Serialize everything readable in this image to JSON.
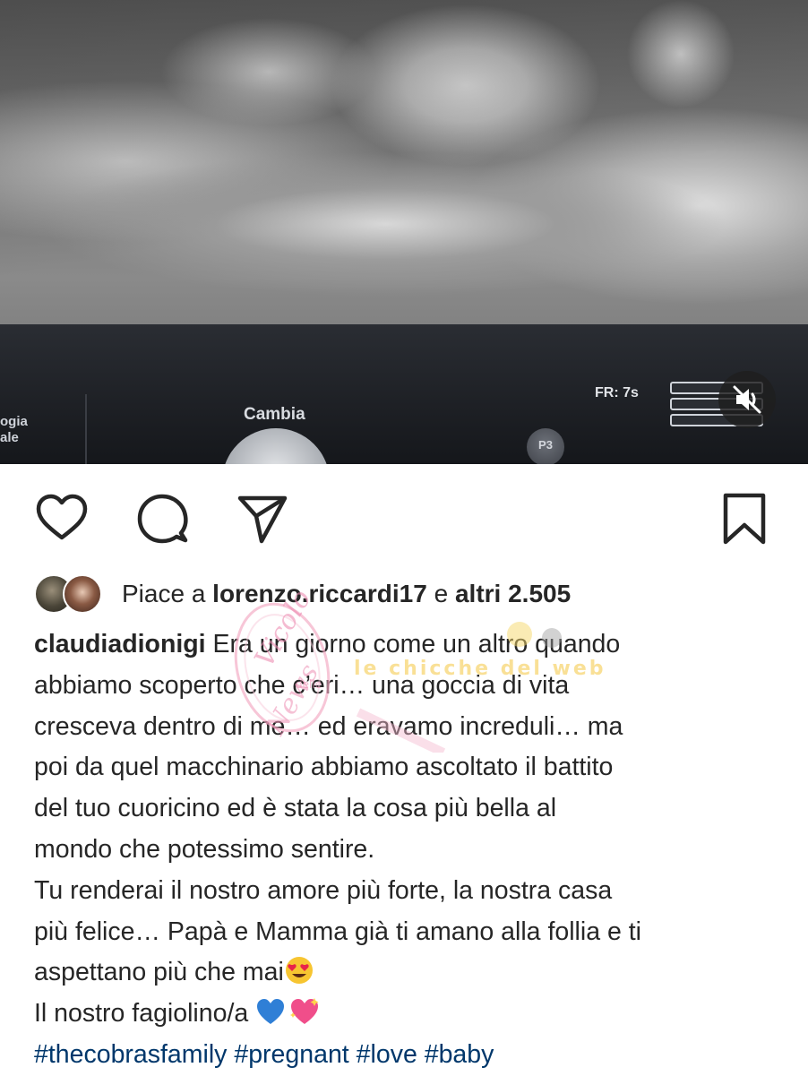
{
  "media": {
    "panel_label_left": "ogia\nale",
    "panel_cambia": "Cambia",
    "panel_p3": "P3",
    "panel_fr": "FR: 7s",
    "mute_icon": "speaker-muted-icon"
  },
  "actions": {
    "like_icon": "heart-icon",
    "comment_icon": "comment-icon",
    "share_icon": "send-icon",
    "save_icon": "bookmark-icon"
  },
  "likes": {
    "prefix": "Piace a ",
    "user": "lorenzo.riccardi17",
    "connector": " e ",
    "others": "altri 2.505"
  },
  "caption": {
    "username": "claudiadionigi",
    "lines": [
      " Era un giorno come un altro quando",
      "abbiamo scoperto che c’eri… una goccia di vita",
      "cresceva dentro di me… ed eravamo increduli… ma",
      "poi da quel macchinario abbiamo ascoltato il battito",
      "del tuo cuoricino ed è stata la cosa più bella al",
      "mondo che potessimo sentire.",
      "Tu renderai il nostro amore più forte, la nostra casa",
      "più felice… Papà e Mamma già ti amano alla follia e ti",
      "aspettano più che mai",
      "Il nostro fagiolino/a "
    ],
    "hashtags": [
      "#thecobrasfamily",
      "#pregnant",
      "#love",
      "#baby"
    ]
  },
  "watermark": {
    "text_main": "Vicolo",
    "text_small": "delle",
    "text_sub": "News",
    "text_right": "le chicche del web"
  },
  "colors": {
    "text": "#262626",
    "hashtag": "#00376b",
    "background": "#ffffff"
  }
}
